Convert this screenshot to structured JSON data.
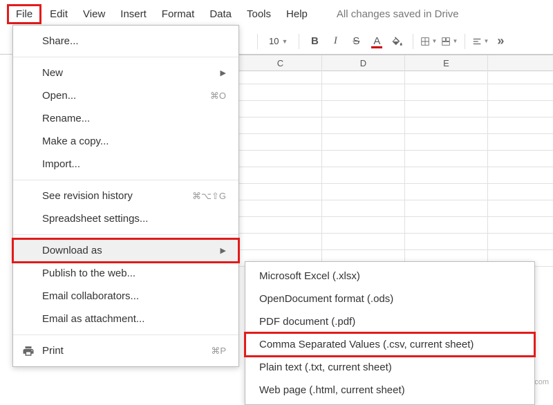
{
  "menubar": {
    "items": [
      "File",
      "Edit",
      "View",
      "Insert",
      "Format",
      "Data",
      "Tools",
      "Help"
    ],
    "save_status": "All changes saved in Drive"
  },
  "toolbar": {
    "font_size": "10",
    "more": "»"
  },
  "columns": [
    "C",
    "D",
    "E"
  ],
  "file_menu": {
    "share": "Share...",
    "new": "New",
    "open": "Open...",
    "open_shortcut": "⌘O",
    "rename": "Rename...",
    "make_copy": "Make a copy...",
    "import": "Import...",
    "revision": "See revision history",
    "revision_shortcut": "⌘⌥⇧G",
    "settings": "Spreadsheet settings...",
    "download": "Download as",
    "publish": "Publish to the web...",
    "email_collab": "Email collaborators...",
    "email_attach": "Email as attachment...",
    "print": "Print",
    "print_shortcut": "⌘P"
  },
  "download_submenu": {
    "xlsx": "Microsoft Excel (.xlsx)",
    "ods": "OpenDocument format (.ods)",
    "pdf": "PDF document (.pdf)",
    "csv": "Comma Separated Values (.csv, current sheet)",
    "txt": "Plain text (.txt, current sheet)",
    "html": "Web page (.html, current sheet)"
  },
  "watermark": "wsxdn.com"
}
